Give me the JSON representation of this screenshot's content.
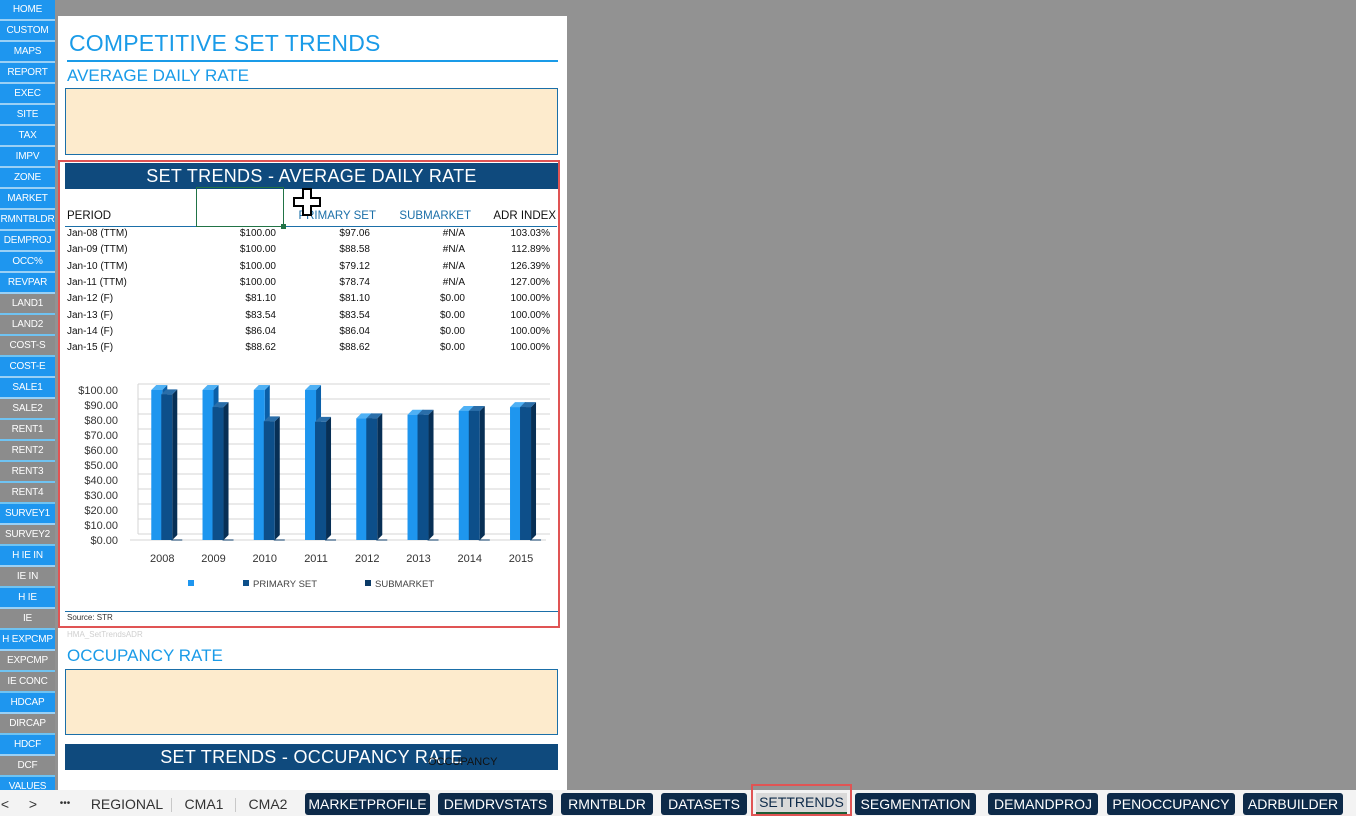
{
  "nav": [
    {
      "label": "HOME",
      "style": "blue"
    },
    {
      "label": "CUSTOM",
      "style": "blue"
    },
    {
      "label": "MAPS",
      "style": "blue"
    },
    {
      "label": "REPORT",
      "style": "blue"
    },
    {
      "label": "EXEC",
      "style": "blue"
    },
    {
      "label": "SITE",
      "style": "blue"
    },
    {
      "label": "TAX",
      "style": "blue"
    },
    {
      "label": "IMPV",
      "style": "blue"
    },
    {
      "label": "ZONE",
      "style": "blue"
    },
    {
      "label": "MARKET",
      "style": "blue"
    },
    {
      "label": "RMNTBLDR",
      "style": "blue"
    },
    {
      "label": "DEMPROJ",
      "style": "blue"
    },
    {
      "label": "OCC%",
      "style": "blue"
    },
    {
      "label": "REVPAR",
      "style": "blue"
    },
    {
      "label": "LAND1",
      "style": "gray"
    },
    {
      "label": "LAND2",
      "style": "gray"
    },
    {
      "label": "COST-S",
      "style": "gray"
    },
    {
      "label": "COST-E",
      "style": "blue"
    },
    {
      "label": "SALE1",
      "style": "blue"
    },
    {
      "label": "SALE2",
      "style": "gray"
    },
    {
      "label": "RENT1",
      "style": "gray"
    },
    {
      "label": "RENT2",
      "style": "gray"
    },
    {
      "label": "RENT3",
      "style": "gray"
    },
    {
      "label": "RENT4",
      "style": "gray"
    },
    {
      "label": "SURVEY1",
      "style": "blue"
    },
    {
      "label": "SURVEY2",
      "style": "gray"
    },
    {
      "label": "H IE IN",
      "style": "blue"
    },
    {
      "label": "IE IN",
      "style": "gray"
    },
    {
      "label": "H IE",
      "style": "blue"
    },
    {
      "label": "IE",
      "style": "gray"
    },
    {
      "label": "H EXPCMP",
      "style": "blue"
    },
    {
      "label": "EXPCMP",
      "style": "gray"
    },
    {
      "label": "IE CONC",
      "style": "gray"
    },
    {
      "label": "HDCAP",
      "style": "blue"
    },
    {
      "label": "DIRCAP",
      "style": "gray"
    },
    {
      "label": "HDCF",
      "style": "blue"
    },
    {
      "label": "DCF",
      "style": "gray"
    },
    {
      "label": "VALUES",
      "style": "blue"
    }
  ],
  "sheet": {
    "title": "COMPETITIVE SET TRENDS",
    "adr_heading": "AVERAGE DAILY RATE",
    "adr_banner": "SET TRENDS - AVERAGE DAILY RATE",
    "columns": [
      "PERIOD",
      "",
      "PRIMARY SET",
      "SUBMARKET",
      "ADR INDEX"
    ],
    "rows": [
      [
        "Jan-08 (TTM)",
        "$100.00",
        "$97.06",
        "#N/A",
        "103.03%"
      ],
      [
        "Jan-09 (TTM)",
        "$100.00",
        "$88.58",
        "#N/A",
        "112.89%"
      ],
      [
        "Jan-10 (TTM)",
        "$100.00",
        "$79.12",
        "#N/A",
        "126.39%"
      ],
      [
        "Jan-11 (TTM)",
        "$100.00",
        "$78.74",
        "#N/A",
        "127.00%"
      ],
      [
        "Jan-12 (F)",
        "$81.10",
        "$81.10",
        "$0.00",
        "100.00%"
      ],
      [
        "Jan-13 (F)",
        "$83.54",
        "$83.54",
        "$0.00",
        "100.00%"
      ],
      [
        "Jan-14 (F)",
        "$86.04",
        "$86.04",
        "$0.00",
        "100.00%"
      ],
      [
        "Jan-15 (F)",
        "$88.62",
        "$88.62",
        "$0.00",
        "100.00%"
      ]
    ],
    "source": "Source: STR",
    "chart_name": "HMA_SetTrendsADR",
    "occ_heading": "OCCUPANCY RATE",
    "occ_banner": "SET TRENDS - OCCUPANCY RATE",
    "occ_col": "OCCUPANCY"
  },
  "chart_data": {
    "type": "bar",
    "categories": [
      "2008",
      "2009",
      "2010",
      "2011",
      "2012",
      "2013",
      "2014",
      "2015"
    ],
    "series": [
      {
        "name": "",
        "values": [
          100.0,
          100.0,
          100.0,
          100.0,
          81.1,
          83.54,
          86.04,
          88.62
        ],
        "color": "#1e96ef"
      },
      {
        "name": "PRIMARY SET",
        "values": [
          97.06,
          88.58,
          79.12,
          78.74,
          81.1,
          83.54,
          86.04,
          88.62
        ],
        "color": "#0d4f8a"
      },
      {
        "name": "SUBMARKET",
        "values": [
          0,
          0,
          0,
          0,
          0,
          0,
          0,
          0
        ],
        "color": "#0a3a66"
      }
    ],
    "yticks": [
      "$100.00",
      "$90.00",
      "$80.00",
      "$70.00",
      "$60.00",
      "$50.00",
      "$40.00",
      "$30.00",
      "$20.00",
      "$10.00",
      "$0.00"
    ],
    "ylim": [
      0,
      100
    ],
    "legend": "bottom",
    "grid": true
  },
  "tabs": [
    {
      "label": "<",
      "style": "nav"
    },
    {
      "label": ">",
      "style": "nav"
    },
    {
      "label": "•••",
      "style": "nav"
    },
    {
      "label": "REGIONAL",
      "style": "plain"
    },
    {
      "label": "CMA1",
      "style": "plain"
    },
    {
      "label": "CMA2",
      "style": "plain"
    },
    {
      "label": "MARKETPROFILE",
      "style": "dark"
    },
    {
      "label": "DEMDRVSTATS",
      "style": "dark"
    },
    {
      "label": "RMNTBLDR",
      "style": "dark"
    },
    {
      "label": "DATASETS",
      "style": "dark"
    },
    {
      "label": "SETTRENDS",
      "style": "active"
    },
    {
      "label": "SEGMENTATION",
      "style": "dark"
    },
    {
      "label": "DEMANDPROJ",
      "style": "dark"
    },
    {
      "label": "PENOCCUPANCY",
      "style": "dark"
    },
    {
      "label": "ADRBUILDER",
      "style": "dark"
    }
  ]
}
